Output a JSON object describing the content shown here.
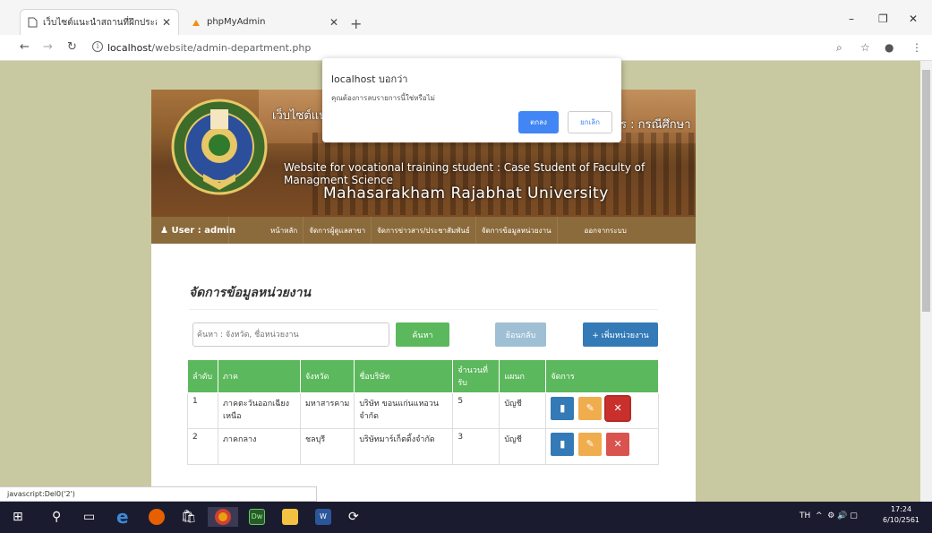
{
  "browser": {
    "tabs": [
      {
        "label": "เว็บไซต์แนะนำสถานที่ฝึกประสบการณ์",
        "active": true
      },
      {
        "label": "phpMyAdmin",
        "active": false
      }
    ],
    "new_tab": "+",
    "window_controls": {
      "minimize": "–",
      "restore": "❐",
      "close": "✕"
    },
    "url_host": "localhost",
    "url_path": "/website/admin-department.php",
    "status_text": "javascript:Del0('2')"
  },
  "banner": {
    "title_left": "เว็บไซต์แนะ",
    "title_right": "ร : กรณีศึกษา",
    "subtitle": "Website for vocational training student : Case Student of Faculty of Managment Science",
    "university": "Mahasarakham Rajabhat University"
  },
  "nav": {
    "user": "User : admin",
    "items": [
      "หน้าหลัก",
      "จัดการผู้ดูแลสาขา",
      "จัดการข่าวสาร/ประชาสัมพันธ์",
      "จัดการข้อมูลหน่วยงาน",
      "ออกจากระบบ"
    ]
  },
  "main": {
    "heading": "จัดการข้อมูลหน่วยงาน",
    "search_placeholder": "ค้นหา : จังหวัด, ชื่อหน่วยงาน",
    "search_button": "ค้นหา",
    "back_button": "ย้อนกลับ",
    "add_button": "+ เพิ่มหน่วยงาน",
    "table": {
      "headers": [
        "ลำดับ",
        "ภาค",
        "จังหวัด",
        "ชื่อบริษัท",
        "จำนวนที่รับ",
        "แผนก",
        "จัดการ"
      ],
      "rows": [
        {
          "no": "1",
          "region": "ภาคตะวันออกเฉียงเหนือ",
          "province": "มหาสารคาม",
          "company": "บริษัท ขอนแก่นแหอวน จำกัด",
          "quota": "5",
          "dept": "บัญชี"
        },
        {
          "no": "2",
          "region": "ภาคกลาง",
          "province": "ชลบุรี",
          "company": "บริษัทมาร์เก็ตติ้งจำกัด",
          "quota": "3",
          "dept": "บัญชี"
        }
      ]
    }
  },
  "dialog": {
    "title": "localhost บอกว่า",
    "message": "คุณต้องการลบรายการนี้ใช่หรือไม่",
    "ok": "ตกลง",
    "cancel": "ยกเลิก"
  },
  "taskbar": {
    "lang": "TH",
    "time": "17:24",
    "date": "6/10/2561"
  },
  "colors": {
    "page_bg": "#c9c9a1",
    "nav_bg": "#8b6a3b",
    "success": "#5cb85c",
    "primary": "#337ab7",
    "warning": "#f0ad4e",
    "danger": "#d9534f",
    "dialog_ok": "#4285f4"
  }
}
